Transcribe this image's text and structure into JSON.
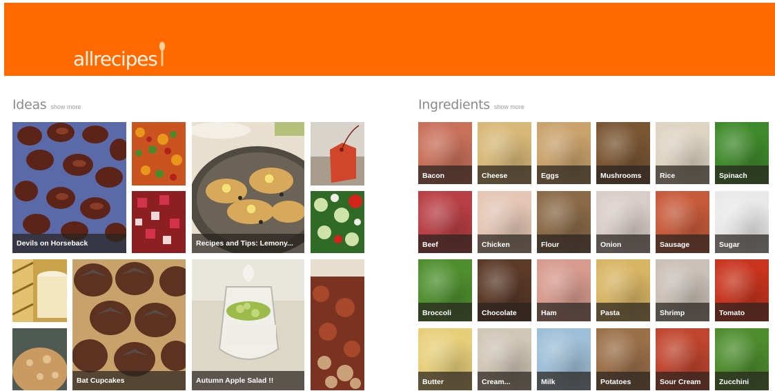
{
  "header": {
    "logo_text": "allrecipes",
    "bg_color": "#ff6900"
  },
  "ideas": {
    "title": "Ideas",
    "show_more": "show more",
    "tiles": [
      {
        "name": "idea-devils-on-horseback",
        "caption": "Devils on Horseback"
      },
      {
        "name": "idea-veggie-salad",
        "caption": ""
      },
      {
        "name": "idea-recipes-tips-lemony",
        "caption": "Recipes and Tips: Lemony..."
      },
      {
        "name": "idea-gift-tag",
        "caption": ""
      },
      {
        "name": "idea-berry-salad",
        "caption": ""
      },
      {
        "name": "idea-cucumber-salad",
        "caption": ""
      },
      {
        "name": "idea-jar-drink",
        "caption": ""
      },
      {
        "name": "idea-bat-cupcakes",
        "caption": "Bat Cupcakes"
      },
      {
        "name": "idea-autumn-apple-salad",
        "caption": "Autumn Apple Salad !!"
      },
      {
        "name": "idea-roast-dish",
        "caption": ""
      },
      {
        "name": "idea-muffin",
        "caption": ""
      }
    ]
  },
  "ingredients": {
    "title": "Ingredients",
    "show_more": "show more",
    "items": [
      {
        "label": "Bacon",
        "color": "#c9705a"
      },
      {
        "label": "Cheese",
        "color": "#d7b878"
      },
      {
        "label": "Eggs",
        "color": "#c9a26c"
      },
      {
        "label": "Mushrooms",
        "color": "#7a5633"
      },
      {
        "label": "Rice",
        "color": "#ddd4c2"
      },
      {
        "label": "Spinach",
        "color": "#3f8a2c"
      },
      {
        "label": "Beef",
        "color": "#b83f45"
      },
      {
        "label": "Chicken",
        "color": "#e4c6b4"
      },
      {
        "label": "Flour",
        "color": "#8a6a48"
      },
      {
        "label": "Onion",
        "color": "#d8cdc9"
      },
      {
        "label": "Sausage",
        "color": "#c75a3a"
      },
      {
        "label": "Sugar",
        "color": "#e9e9e9"
      },
      {
        "label": "Broccoli",
        "color": "#4f8f2f"
      },
      {
        "label": "Chocolate",
        "color": "#5b3a28"
      },
      {
        "label": "Ham",
        "color": "#d79a8e"
      },
      {
        "label": "Pasta",
        "color": "#d8b564"
      },
      {
        "label": "Shrimp",
        "color": "#c9c0b8"
      },
      {
        "label": "Tomato",
        "color": "#c8341e"
      },
      {
        "label": "Butter",
        "color": "#e7cf7a"
      },
      {
        "label": "Cream...",
        "color": "#cfc6b5"
      },
      {
        "label": "Milk",
        "color": "#9fbfd8"
      },
      {
        "label": "Potatoes",
        "color": "#9b7049"
      },
      {
        "label": "Sour Cream",
        "color": "#c0452e"
      },
      {
        "label": "Zucchini",
        "color": "#4e8d2e"
      }
    ]
  }
}
